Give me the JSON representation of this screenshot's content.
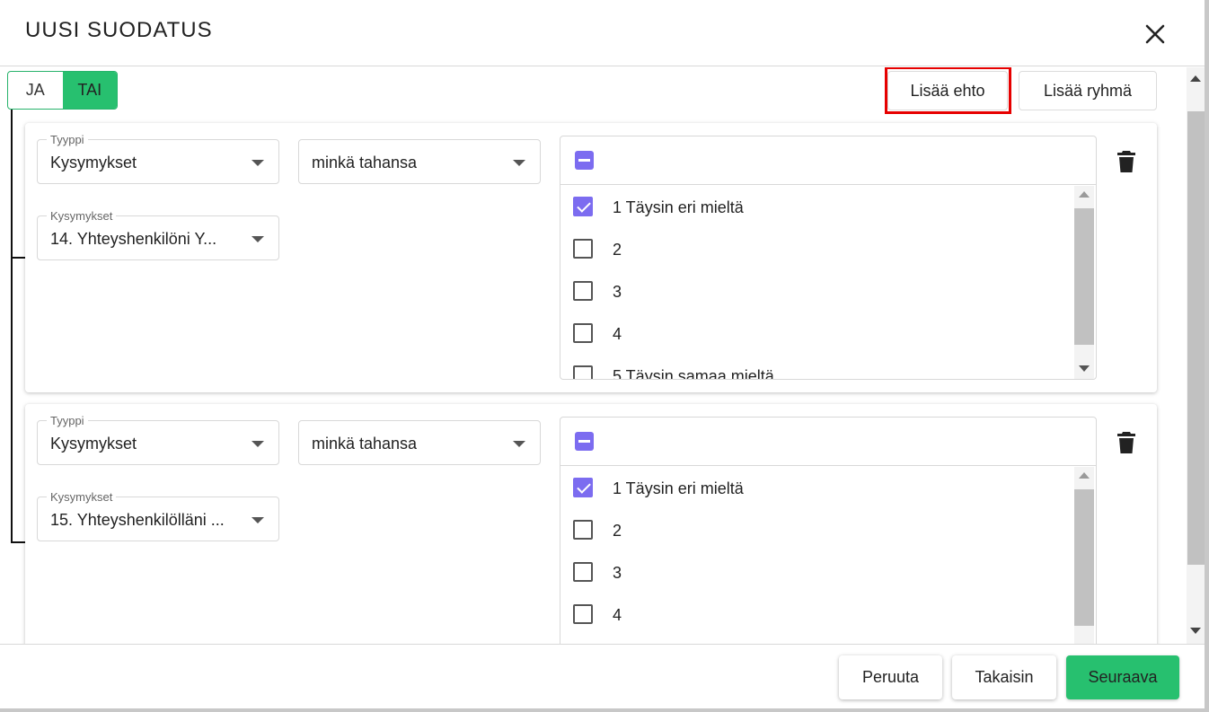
{
  "dialog": {
    "title": "UUSI SUODATUS"
  },
  "logic_toggle": {
    "options": [
      "JA",
      "TAI"
    ],
    "active": "TAI"
  },
  "toolbar": {
    "add_condition": "Lisää ehto",
    "add_group": "Lisää ryhmä"
  },
  "conditions": [
    {
      "type_label": "Tyyppi",
      "type_value": "Kysymykset",
      "operator_value": "minkä tahansa",
      "question_label": "Kysymykset",
      "question_value": "14. Yhteyshenkilöni Y...",
      "options": [
        {
          "label": "1 Täysin eri mieltä",
          "checked": true
        },
        {
          "label": "2",
          "checked": false
        },
        {
          "label": "3",
          "checked": false
        },
        {
          "label": "4",
          "checked": false
        },
        {
          "label": "5 Täysin samaa mieltä",
          "checked": false
        }
      ]
    },
    {
      "type_label": "Tyyppi",
      "type_value": "Kysymykset",
      "operator_value": "minkä tahansa",
      "question_label": "Kysymykset",
      "question_value": "15. Yhteyshenkilölläni ...",
      "options": [
        {
          "label": "1 Täysin eri mieltä",
          "checked": true
        },
        {
          "label": "2",
          "checked": false
        },
        {
          "label": "3",
          "checked": false
        },
        {
          "label": "4",
          "checked": false
        }
      ]
    }
  ],
  "footer": {
    "cancel": "Peruuta",
    "back": "Takaisin",
    "next": "Seuraava"
  },
  "colors": {
    "accent_green": "#27c06f",
    "checkbox_purple": "#7c6cf0",
    "highlight_red": "#e60000"
  }
}
